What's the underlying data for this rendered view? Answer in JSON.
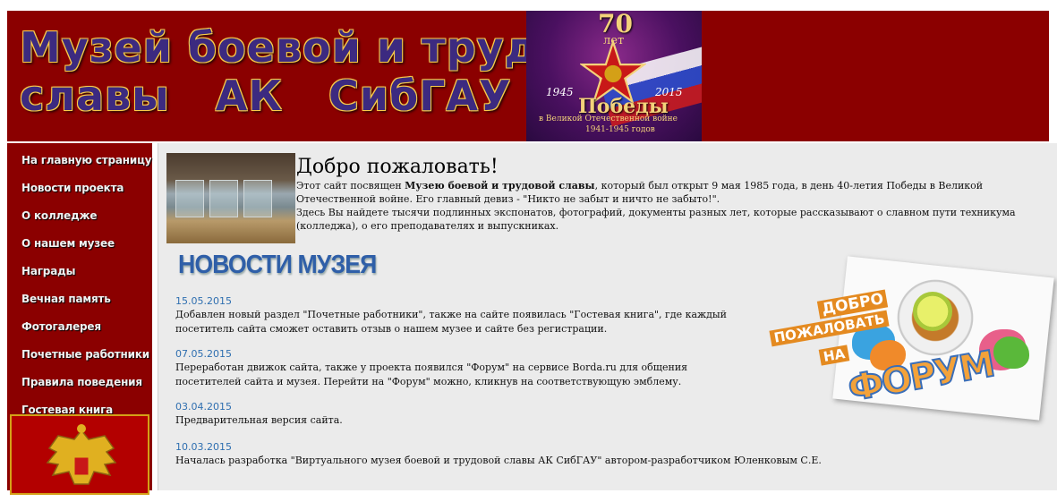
{
  "header": {
    "logo_line1": "Музей боевой и трудовой",
    "logo_line2": "славы   АК   СибГАУ",
    "banner": {
      "big_number": "70",
      "years_word": "лет",
      "year_start": "1945",
      "year_end": "2015",
      "title": "Победы",
      "subtitle1": "в Великой Отечественной войне",
      "subtitle2": "1941-1945 годов"
    }
  },
  "sidebar": {
    "items": [
      {
        "label": "На главную страницу"
      },
      {
        "label": "Новости проекта"
      },
      {
        "label": "О колледже"
      },
      {
        "label": "О нашем музее"
      },
      {
        "label": "Награды"
      },
      {
        "label": "Вечная память"
      },
      {
        "label": "Фотогалерея"
      },
      {
        "label": "Почетные работники"
      },
      {
        "label": "Правила поведения"
      },
      {
        "label": "Гостевая книга"
      }
    ]
  },
  "welcome": {
    "title": "Добро пожаловать!",
    "line1_before": "Этот сайт посвящен ",
    "line1_bold": "Музею боевой и трудовой славы",
    "line1_after": ", который был открыт 9 мая 1985 года, в день 40-летия Победы в Великой Отечественной войне. Его главный девиз - \"Никто не забыт и ничто не забыто!\".",
    "line2": "Здесь Вы найдете тысячи подлинных экспонатов, фотографий, документы разных лет, которые рассказывают о славном пути техникума (колледжа), о его преподавателях и выпускниках."
  },
  "news": {
    "heading": "НОВОСТИ МУЗЕЯ",
    "items": [
      {
        "date": "15.05.2015",
        "text": "Добавлен новый раздел \"Почетные работники\", также на сайте появилась \"Гостевая книга\", где каждый посетитель сайта сможет оставить отзыв о нашем музее и сайте без регистрации."
      },
      {
        "date": "07.05.2015",
        "text": "Переработан движок сайта, также у проекта появился \"Форум\" на сервисе Borda.ru для общения посетителей сайта и музея. Перейти на \"Форум\" можно, кликнув на соответствующую эмблему."
      },
      {
        "date": "03.04.2015",
        "text": "Предварительная версия сайта."
      },
      {
        "date": "10.03.2015",
        "text": "Началась разработка \"Виртуального музея боевой и трудовой славы АК СибГАУ\" автором-разработчиком Юленковым С.Е."
      }
    ]
  },
  "forum_banner": {
    "word1": "ДОБРО",
    "word2": "ПОЖАЛОВАТЬ",
    "word3": "НА",
    "word4": "ФОРУМ"
  },
  "colors": {
    "header_bg": "#8b0000",
    "sidebar_bg": "#8b0000",
    "content_bg": "#ebebeb",
    "news_heading": "#2f5fa8",
    "news_date": "#2f6fb0"
  }
}
